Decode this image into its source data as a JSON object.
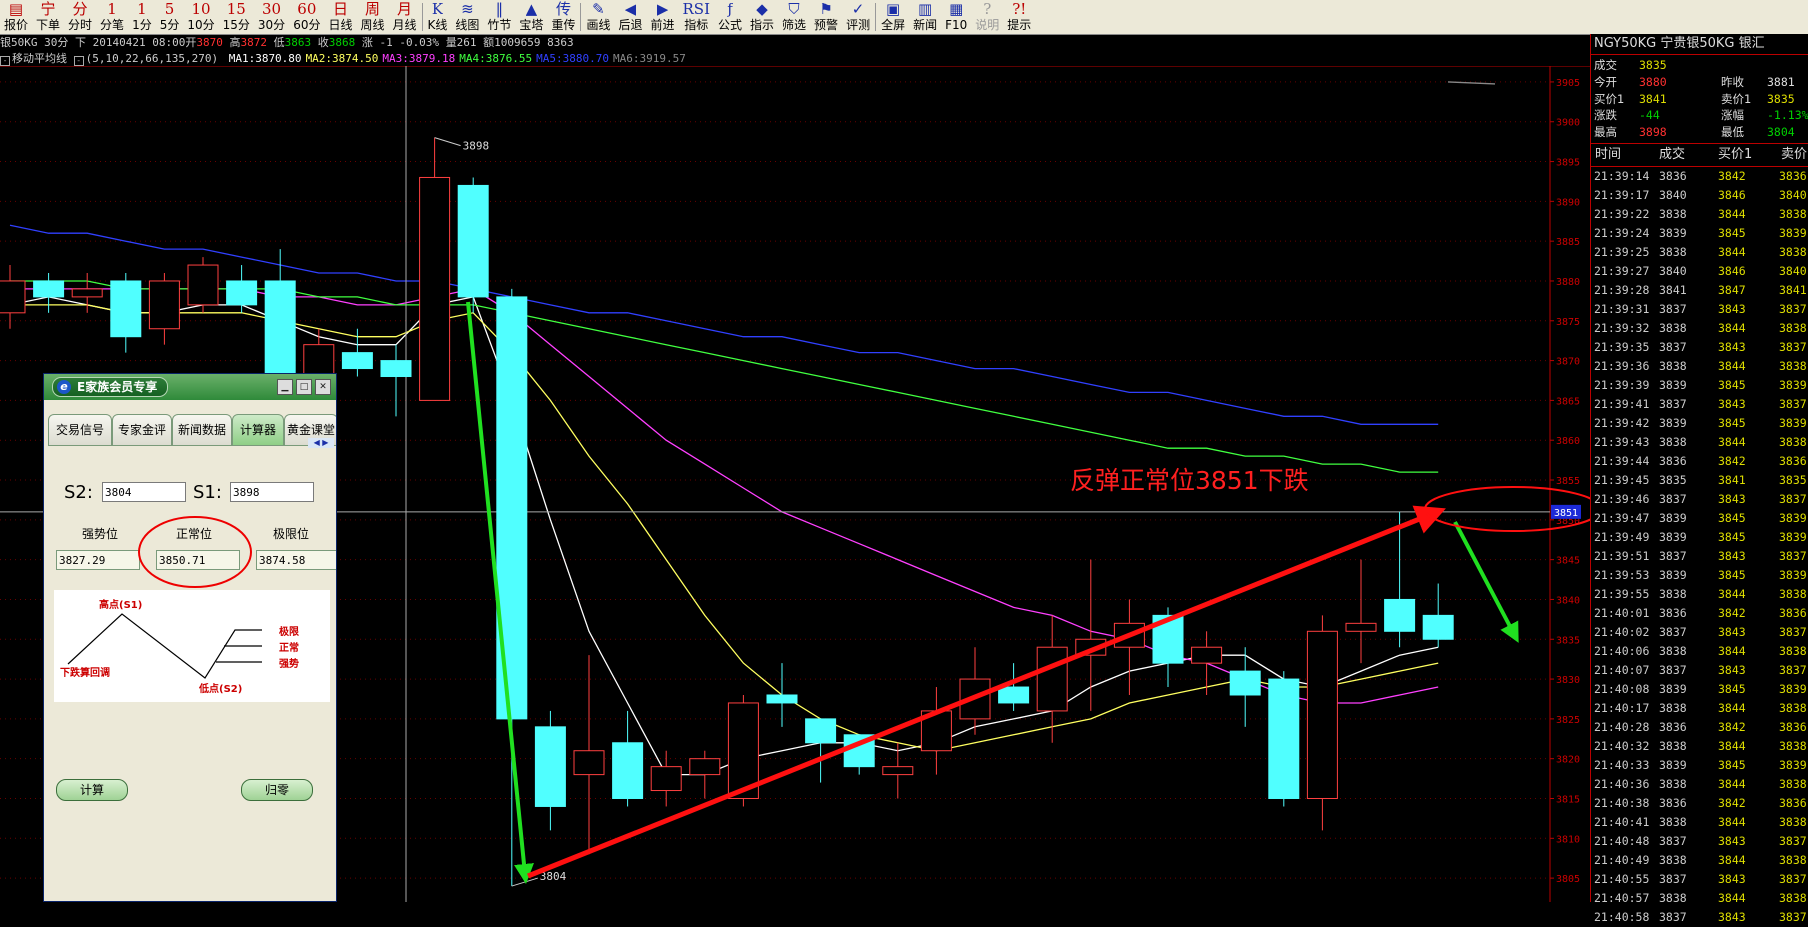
{
  "toolbar": {
    "buttons": [
      {
        "icon": "▤",
        "label": "报价"
      },
      {
        "icon": "宁",
        "label": "下单"
      },
      {
        "icon": "分",
        "label": "分时"
      },
      {
        "icon": "1",
        "label": "分笔"
      },
      {
        "icon": "1",
        "label": "1分"
      },
      {
        "icon": "5",
        "label": "5分"
      },
      {
        "icon": "10",
        "label": "10分"
      },
      {
        "icon": "15",
        "label": "15分"
      },
      {
        "icon": "30",
        "label": "30分"
      },
      {
        "icon": "60",
        "label": "60分"
      },
      {
        "icon": "日",
        "label": "日线"
      },
      {
        "icon": "周",
        "label": "周线"
      },
      {
        "icon": "月",
        "label": "月线"
      },
      {
        "icon": "K",
        "label": "K线"
      },
      {
        "icon": "≋",
        "label": "线图"
      },
      {
        "icon": "‖",
        "label": "竹节"
      },
      {
        "icon": "▲",
        "label": "宝塔"
      },
      {
        "icon": "传",
        "label": "重传"
      },
      {
        "icon": "✎",
        "label": "画线"
      },
      {
        "icon": "◀",
        "label": "后退"
      },
      {
        "icon": "▶",
        "label": "前进"
      },
      {
        "icon": "RSI",
        "label": "指标"
      },
      {
        "icon": "ƒ",
        "label": "公式"
      },
      {
        "icon": "◆",
        "label": "指示"
      },
      {
        "icon": "⛉",
        "label": "筛选"
      },
      {
        "icon": "⚑",
        "label": "预警"
      },
      {
        "icon": "✓",
        "label": "评测"
      },
      {
        "icon": "▣",
        "label": "全屏"
      },
      {
        "icon": "▥",
        "label": "新闻"
      },
      {
        "icon": "▦",
        "label": "F10"
      },
      {
        "icon": "?",
        "label": "说明"
      },
      {
        "icon": "?!",
        "label": "提示"
      }
    ]
  },
  "infoline": {
    "symbol": "银50KG 30分 下",
    "date_label": "20140421 08:00开",
    "open": "3870",
    "high_label": "高",
    "high": "3872",
    "low_label": "低",
    "low": "3863",
    "close_label": "收",
    "close": "3868",
    "change": "涨 -1  -0.03%",
    "volume": "量261 额1009659 8363"
  },
  "ma_line": {
    "title": "移动平均线",
    "params": "(5,10,22,66,135,270)",
    "items": [
      {
        "label": "MA1:3870.80",
        "color": "#ffffff"
      },
      {
        "label": "MA2:3874.50",
        "color": "#ffff60"
      },
      {
        "label": "MA3:3879.18",
        "color": "#ff40ff"
      },
      {
        "label": "MA4:3876.55",
        "color": "#40ff40"
      },
      {
        "label": "MA5:3880.70",
        "color": "#3040ff"
      },
      {
        "label": "MA6:3919.57",
        "color": "#888888"
      }
    ]
  },
  "chart_data": {
    "type": "candlestick",
    "yaxis": {
      "min": 3802,
      "max": 3907,
      "ticks": [
        3805,
        3810,
        3815,
        3820,
        3825,
        3830,
        3835,
        3840,
        3845,
        3850,
        3855,
        3860,
        3865,
        3870,
        3875,
        3880,
        3885,
        3890,
        3895,
        3900,
        3905
      ]
    },
    "current_price_label": "3851",
    "high_label": "3898",
    "low_label": "3804",
    "candles": [
      {
        "o": 3876,
        "c": 3880,
        "h": 3882,
        "l": 3874
      },
      {
        "o": 3880,
        "c": 3878,
        "h": 3881,
        "l": 3876
      },
      {
        "o": 3878,
        "c": 3879,
        "h": 3881,
        "l": 3876
      },
      {
        "o": 3880,
        "c": 3873,
        "h": 3881,
        "l": 3871
      },
      {
        "o": 3874,
        "c": 3880,
        "h": 3881,
        "l": 3872
      },
      {
        "o": 3877,
        "c": 3882,
        "h": 3883,
        "l": 3876
      },
      {
        "o": 3880,
        "c": 3877,
        "h": 3882,
        "l": 3876
      },
      {
        "o": 3880,
        "c": 3867,
        "h": 3884,
        "l": 3866
      },
      {
        "o": 3866,
        "c": 3872,
        "h": 3874,
        "l": 3863
      },
      {
        "o": 3871,
        "c": 3869,
        "h": 3874,
        "l": 3868
      },
      {
        "o": 3870,
        "c": 3868,
        "h": 3872,
        "l": 3863
      },
      {
        "o": 3865,
        "c": 3893,
        "h": 3898,
        "l": 3865
      },
      {
        "o": 3892,
        "c": 3878,
        "h": 3893,
        "l": 3876
      },
      {
        "o": 3878,
        "c": 3825,
        "h": 3879,
        "l": 3804
      },
      {
        "o": 3824,
        "c": 3814,
        "h": 3826,
        "l": 3811
      },
      {
        "o": 3818,
        "c": 3821,
        "h": 3833,
        "l": 3808
      },
      {
        "o": 3822,
        "c": 3815,
        "h": 3826,
        "l": 3814
      },
      {
        "o": 3816,
        "c": 3819,
        "h": 3821,
        "l": 3814
      },
      {
        "o": 3818,
        "c": 3820,
        "h": 3821,
        "l": 3815
      },
      {
        "o": 3815,
        "c": 3827,
        "h": 3828,
        "l": 3814
      },
      {
        "o": 3828,
        "c": 3827,
        "h": 3832,
        "l": 3824
      },
      {
        "o": 3825,
        "c": 3822,
        "h": 3825,
        "l": 3817
      },
      {
        "o": 3823,
        "c": 3819,
        "h": 3823,
        "l": 3818
      },
      {
        "o": 3818,
        "c": 3819,
        "h": 3822,
        "l": 3815
      },
      {
        "o": 3821,
        "c": 3826,
        "h": 3829,
        "l": 3818
      },
      {
        "o": 3825,
        "c": 3830,
        "h": 3834,
        "l": 3823
      },
      {
        "o": 3829,
        "c": 3827,
        "h": 3832,
        "l": 3826
      },
      {
        "o": 3826,
        "c": 3834,
        "h": 3838,
        "l": 3822
      },
      {
        "o": 3833,
        "c": 3835,
        "h": 3845,
        "l": 3826
      },
      {
        "o": 3834,
        "c": 3837,
        "h": 3840,
        "l": 3828
      },
      {
        "o": 3838,
        "c": 3832,
        "h": 3839,
        "l": 3829
      },
      {
        "o": 3832,
        "c": 3834,
        "h": 3836,
        "l": 3828
      },
      {
        "o": 3831,
        "c": 3828,
        "h": 3834,
        "l": 3824
      },
      {
        "o": 3830,
        "c": 3815,
        "h": 3831,
        "l": 3814
      },
      {
        "o": 3815,
        "c": 3836,
        "h": 3838,
        "l": 3811
      },
      {
        "o": 3836,
        "c": 3837,
        "h": 3845,
        "l": 3832
      },
      {
        "o": 3840,
        "c": 3836,
        "h": 3851,
        "l": 3834
      },
      {
        "o": 3838,
        "c": 3835,
        "h": 3842,
        "l": 3834
      }
    ],
    "ma_lines": {
      "ma1": [
        3877,
        3878,
        3877,
        3876,
        3876,
        3877,
        3877,
        3875,
        3873,
        3872,
        3872,
        3877,
        3878,
        3865,
        3850,
        3836,
        3827,
        3818,
        3818,
        3820,
        3821,
        3822,
        3822,
        3821,
        3822,
        3824,
        3825,
        3826,
        3829,
        3831,
        3832,
        3833,
        3833,
        3830,
        3829,
        3831,
        3833,
        3834
      ],
      "ma2": [
        3877,
        3877,
        3877,
        3876,
        3876,
        3876,
        3876,
        3875,
        3874,
        3873,
        3873,
        3875,
        3876,
        3871,
        3865,
        3858,
        3852,
        3845,
        3838,
        3832,
        3828,
        3825,
        3823,
        3822,
        3821,
        3822,
        3823,
        3824,
        3825,
        3827,
        3828,
        3829,
        3830,
        3829,
        3829,
        3830,
        3831,
        3832
      ],
      "ma3": [
        3879,
        3879,
        3879,
        3879,
        3879,
        3879,
        3879,
        3878,
        3878,
        3877,
        3877,
        3878,
        3879,
        3876,
        3872,
        3868,
        3864,
        3860,
        3857,
        3854,
        3851,
        3849,
        3847,
        3845,
        3843,
        3841,
        3839,
        3838,
        3836,
        3835,
        3833,
        3832,
        3830,
        3828,
        3827,
        3827,
        3828,
        3829
      ],
      "ma4": [
        3880,
        3880,
        3880,
        3879,
        3879,
        3879,
        3879,
        3879,
        3878,
        3878,
        3877,
        3877,
        3877,
        3876,
        3875,
        3874,
        3873,
        3872,
        3871,
        3870,
        3869,
        3868,
        3867,
        3866,
        3865,
        3864,
        3863,
        3862,
        3861,
        3860,
        3859,
        3859,
        3858,
        3858,
        3857,
        3857,
        3856,
        3856
      ],
      "ma5": [
        3887,
        3886,
        3886,
        3885,
        3884,
        3884,
        3883,
        3882,
        3881,
        3881,
        3880,
        3880,
        3879,
        3878,
        3877,
        3876,
        3876,
        3875,
        3874,
        3873,
        3873,
        3872,
        3871,
        3871,
        3870,
        3869,
        3869,
        3868,
        3867,
        3866,
        3866,
        3865,
        3864,
        3863,
        3863,
        3862,
        3862,
        3862
      ],
      "ma6": [
        3905,
        3905
      ]
    }
  },
  "annotation": {
    "text": "反弹正常位3851下跌"
  },
  "right_panel": {
    "title": "NGY50KG 宁贵银50KG  银汇",
    "quotes": [
      {
        "l1": "成交",
        "v1": "3835",
        "l2": "",
        "v2": ""
      },
      {
        "l1": "今开",
        "v1": "3880",
        "l2": "昨收",
        "v2": "3881"
      },
      {
        "l1": "买价1",
        "v1": "3841",
        "l2": "卖价1",
        "v2": "3835"
      },
      {
        "l1": "涨跌",
        "v1": "-44",
        "l2": "涨幅",
        "v2": "-1.13%"
      },
      {
        "l1": "最高",
        "v1": "3898",
        "l2": "最低",
        "v2": "3804"
      }
    ],
    "headers": [
      "时间",
      "成交",
      "买价1",
      "卖价"
    ],
    "ticks": [
      [
        "21:39:14",
        "3836",
        "3842",
        "3836"
      ],
      [
        "21:39:17",
        "3840",
        "3846",
        "3840"
      ],
      [
        "21:39:22",
        "3838",
        "3844",
        "3838"
      ],
      [
        "21:39:24",
        "3839",
        "3845",
        "3839"
      ],
      [
        "21:39:25",
        "3838",
        "3844",
        "3838"
      ],
      [
        "21:39:27",
        "3840",
        "3846",
        "3840"
      ],
      [
        "21:39:28",
        "3841",
        "3847",
        "3841"
      ],
      [
        "21:39:31",
        "3837",
        "3843",
        "3837"
      ],
      [
        "21:39:32",
        "3838",
        "3844",
        "3838"
      ],
      [
        "21:39:35",
        "3837",
        "3843",
        "3837"
      ],
      [
        "21:39:36",
        "3838",
        "3844",
        "3838"
      ],
      [
        "21:39:39",
        "3839",
        "3845",
        "3839"
      ],
      [
        "21:39:41",
        "3837",
        "3843",
        "3837"
      ],
      [
        "21:39:42",
        "3839",
        "3845",
        "3839"
      ],
      [
        "21:39:43",
        "3838",
        "3844",
        "3838"
      ],
      [
        "21:39:44",
        "3836",
        "3842",
        "3836"
      ],
      [
        "21:39:45",
        "3835",
        "3841",
        "3835"
      ],
      [
        "21:39:46",
        "3837",
        "3843",
        "3837"
      ],
      [
        "21:39:47",
        "3839",
        "3845",
        "3839"
      ],
      [
        "21:39:49",
        "3839",
        "3845",
        "3839"
      ],
      [
        "21:39:51",
        "3837",
        "3843",
        "3837"
      ],
      [
        "21:39:53",
        "3839",
        "3845",
        "3839"
      ],
      [
        "21:39:55",
        "3838",
        "3844",
        "3838"
      ],
      [
        "21:40:01",
        "3836",
        "3842",
        "3836"
      ],
      [
        "21:40:02",
        "3837",
        "3843",
        "3837"
      ],
      [
        "21:40:06",
        "3838",
        "3844",
        "3838"
      ],
      [
        "21:40:07",
        "3837",
        "3843",
        "3837"
      ],
      [
        "21:40:08",
        "3839",
        "3845",
        "3839"
      ],
      [
        "21:40:17",
        "3838",
        "3844",
        "3838"
      ],
      [
        "21:40:28",
        "3836",
        "3842",
        "3836"
      ],
      [
        "21:40:32",
        "3838",
        "3844",
        "3838"
      ],
      [
        "21:40:33",
        "3839",
        "3845",
        "3839"
      ],
      [
        "21:40:36",
        "3838",
        "3844",
        "3838"
      ],
      [
        "21:40:38",
        "3836",
        "3842",
        "3836"
      ],
      [
        "21:40:41",
        "3838",
        "3844",
        "3838"
      ],
      [
        "21:40:48",
        "3837",
        "3843",
        "3837"
      ],
      [
        "21:40:49",
        "3838",
        "3844",
        "3838"
      ],
      [
        "21:40:55",
        "3837",
        "3843",
        "3837"
      ],
      [
        "21:40:57",
        "3838",
        "3844",
        "3838"
      ],
      [
        "21:40:58",
        "3837",
        "3843",
        "3837"
      ]
    ]
  },
  "popup": {
    "title": "E家族会员专享",
    "logo": "e",
    "tabs": [
      "交易信号",
      "专家金评",
      "新闻数据",
      "计算器",
      "黄金课堂"
    ],
    "active_tab": "计算器",
    "s2_label": "S2:",
    "s2_value": "3804",
    "s1_label": "S1:",
    "s1_value": "3898",
    "outputs": [
      {
        "label": "强势位",
        "value": "3827.29"
      },
      {
        "label": "正常位",
        "value": "3850.71"
      },
      {
        "label": "极限位",
        "value": "3874.58"
      }
    ],
    "diagram": {
      "high": "高点(S1)",
      "low": "低点(S2)",
      "pullback": "下跌算回调",
      "limit": "极限",
      "normal": "正常",
      "strong": "强势"
    },
    "calc_button": "计算",
    "reset_button": "归零"
  }
}
